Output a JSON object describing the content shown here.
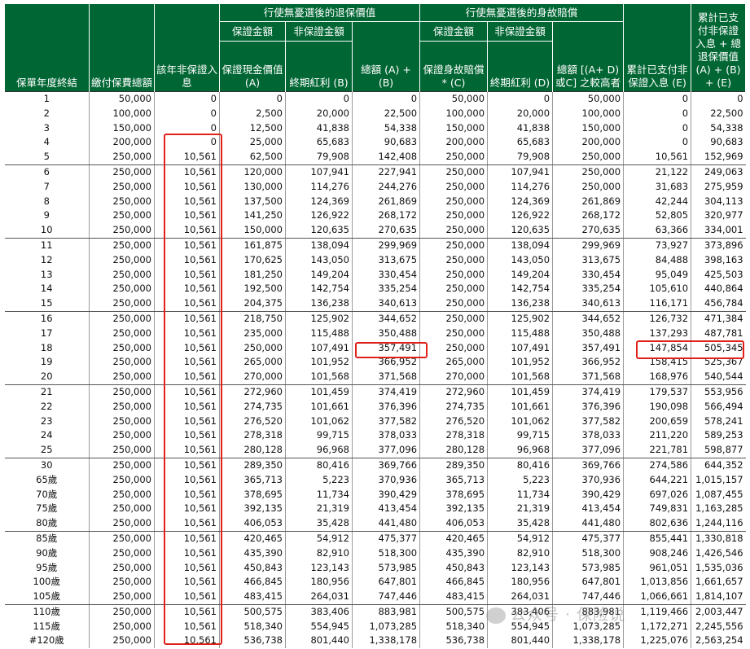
{
  "headers": {
    "col0": "保單年度終結",
    "col1": "繳付保費總額",
    "col2": "該年非保證入息",
    "group_surrender": "行使無憂選後的退保價值",
    "group_death": "行使無憂選後的身故賠償",
    "guaranteed": "保證金額",
    "non_guaranteed": "非保證金額",
    "guaranteed_cash_value": "保證現金價值 (A)",
    "terminal_bonus": "終期紅利 (B)",
    "total_surrender": "總額 (A) + (B)",
    "guaranteed_death_benefit": "保證身故賠償* (C)",
    "terminal_bonus_death": "終期紅利 (D)",
    "total_death": "總額 [(A+ D) 或C] 之較高者",
    "cumulative_income": "累計已支付非保證入息 (E)",
    "cumulative_total": "累計已支付非保證入息 + 總退保價值 (A) + (B) + (E)"
  },
  "rows": [
    [
      "1",
      "50,000",
      "0",
      "0",
      "0",
      "0",
      "50,000",
      "0",
      "50,000",
      "0",
      "0"
    ],
    [
      "2",
      "100,000",
      "0",
      "2,500",
      "20,000",
      "22,500",
      "100,000",
      "20,000",
      "100,000",
      "0",
      "22,500"
    ],
    [
      "3",
      "150,000",
      "0",
      "12,500",
      "41,838",
      "54,338",
      "150,000",
      "41,838",
      "150,000",
      "0",
      "54,338"
    ],
    [
      "4",
      "200,000",
      "0",
      "25,000",
      "65,683",
      "90,683",
      "200,000",
      "65,683",
      "200,000",
      "0",
      "90,683"
    ],
    [
      "5",
      "250,000",
      "10,561",
      "62,500",
      "79,908",
      "142,408",
      "250,000",
      "79,908",
      "250,000",
      "10,561",
      "152,969"
    ],
    [
      "6",
      "250,000",
      "10,561",
      "120,000",
      "107,941",
      "227,941",
      "250,000",
      "107,941",
      "250,000",
      "21,122",
      "249,063"
    ],
    [
      "7",
      "250,000",
      "10,561",
      "130,000",
      "114,276",
      "244,276",
      "250,000",
      "114,276",
      "250,000",
      "31,683",
      "275,959"
    ],
    [
      "8",
      "250,000",
      "10,561",
      "137,500",
      "124,369",
      "261,869",
      "250,000",
      "124,369",
      "261,869",
      "42,244",
      "304,113"
    ],
    [
      "9",
      "250,000",
      "10,561",
      "141,250",
      "126,922",
      "268,172",
      "250,000",
      "126,922",
      "268,172",
      "52,805",
      "320,977"
    ],
    [
      "10",
      "250,000",
      "10,561",
      "150,000",
      "120,635",
      "270,635",
      "250,000",
      "120,635",
      "270,635",
      "63,366",
      "334,001"
    ],
    [
      "11",
      "250,000",
      "10,561",
      "161,875",
      "138,094",
      "299,969",
      "250,000",
      "138,094",
      "299,969",
      "73,927",
      "373,896"
    ],
    [
      "12",
      "250,000",
      "10,561",
      "170,625",
      "143,050",
      "313,675",
      "250,000",
      "143,050",
      "313,675",
      "84,488",
      "398,163"
    ],
    [
      "13",
      "250,000",
      "10,561",
      "181,250",
      "149,204",
      "330,454",
      "250,000",
      "149,204",
      "330,454",
      "95,049",
      "425,503"
    ],
    [
      "14",
      "250,000",
      "10,561",
      "192,500",
      "142,754",
      "335,254",
      "250,000",
      "142,754",
      "335,254",
      "105,610",
      "440,864"
    ],
    [
      "15",
      "250,000",
      "10,561",
      "204,375",
      "136,238",
      "340,613",
      "250,000",
      "136,238",
      "340,613",
      "116,171",
      "456,784"
    ],
    [
      "16",
      "250,000",
      "10,561",
      "218,750",
      "125,902",
      "344,652",
      "250,000",
      "125,902",
      "344,652",
      "126,732",
      "471,384"
    ],
    [
      "17",
      "250,000",
      "10,561",
      "235,000",
      "115,488",
      "350,488",
      "250,000",
      "115,488",
      "350,488",
      "137,293",
      "487,781"
    ],
    [
      "18",
      "250,000",
      "10,561",
      "250,000",
      "107,491",
      "357,491",
      "250,000",
      "107,491",
      "357,491",
      "147,854",
      "505,345"
    ],
    [
      "19",
      "250,000",
      "10,561",
      "265,000",
      "101,952",
      "366,952",
      "265,000",
      "101,952",
      "366,952",
      "158,415",
      "525,367"
    ],
    [
      "20",
      "250,000",
      "10,561",
      "270,000",
      "101,568",
      "371,568",
      "270,000",
      "101,568",
      "371,568",
      "168,976",
      "540,544"
    ],
    [
      "21",
      "250,000",
      "10,561",
      "272,960",
      "101,459",
      "374,419",
      "272,960",
      "101,459",
      "374,419",
      "179,537",
      "553,956"
    ],
    [
      "22",
      "250,000",
      "10,561",
      "274,735",
      "101,661",
      "376,396",
      "274,735",
      "101,661",
      "376,396",
      "190,098",
      "566,494"
    ],
    [
      "23",
      "250,000",
      "10,561",
      "276,520",
      "101,062",
      "377,582",
      "276,520",
      "101,062",
      "377,582",
      "200,659",
      "578,241"
    ],
    [
      "24",
      "250,000",
      "10,561",
      "278,318",
      "99,715",
      "378,033",
      "278,318",
      "99,715",
      "378,033",
      "211,220",
      "589,253"
    ],
    [
      "25",
      "250,000",
      "10,561",
      "280,128",
      "96,968",
      "377,096",
      "280,128",
      "96,968",
      "377,096",
      "221,781",
      "598,877"
    ],
    [
      "30",
      "250,000",
      "10,561",
      "289,350",
      "80,416",
      "369,766",
      "289,350",
      "80,416",
      "369,766",
      "274,586",
      "644,352"
    ],
    [
      "65歲",
      "250,000",
      "10,561",
      "365,713",
      "5,223",
      "370,936",
      "365,713",
      "5,223",
      "370,936",
      "644,221",
      "1,015,157"
    ],
    [
      "70歲",
      "250,000",
      "10,561",
      "378,695",
      "11,734",
      "390,429",
      "378,695",
      "11,734",
      "390,429",
      "697,026",
      "1,087,455"
    ],
    [
      "75歲",
      "250,000",
      "10,561",
      "392,135",
      "21,319",
      "413,454",
      "392,135",
      "21,319",
      "413,454",
      "749,831",
      "1,163,285"
    ],
    [
      "80歲",
      "250,000",
      "10,561",
      "406,053",
      "35,428",
      "441,480",
      "406,053",
      "35,428",
      "441,480",
      "802,636",
      "1,244,116"
    ],
    [
      "85歲",
      "250,000",
      "10,561",
      "420,465",
      "54,912",
      "475,377",
      "420,465",
      "54,912",
      "475,377",
      "855,441",
      "1,330,818"
    ],
    [
      "90歲",
      "250,000",
      "10,561",
      "435,390",
      "82,910",
      "518,300",
      "435,390",
      "82,910",
      "518,300",
      "908,246",
      "1,426,546"
    ],
    [
      "95歲",
      "250,000",
      "10,561",
      "450,843",
      "123,143",
      "573,985",
      "450,843",
      "123,143",
      "573,985",
      "961,051",
      "1,535,036"
    ],
    [
      "100歲",
      "250,000",
      "10,561",
      "466,845",
      "180,956",
      "647,801",
      "466,845",
      "180,956",
      "647,801",
      "1,013,856",
      "1,661,657"
    ],
    [
      "105歲",
      "250,000",
      "10,561",
      "483,415",
      "264,031",
      "747,446",
      "483,415",
      "264,031",
      "747,446",
      "1,066,661",
      "1,814,107"
    ],
    [
      "110歲",
      "250,000",
      "10,561",
      "500,575",
      "383,406",
      "883,981",
      "500,575",
      "383,406",
      "883,981",
      "1,119,466",
      "2,003,447"
    ],
    [
      "115歲",
      "250,000",
      "10,561",
      "518,340",
      "554,945",
      "1,073,285",
      "518,340",
      "554,945",
      "1,073,285",
      "1,172,271",
      "2,245,556"
    ],
    [
      "#120歲",
      "250,000",
      "10,561",
      "536,738",
      "801,440",
      "1,338,178",
      "536,738",
      "801,440",
      "1,338,178",
      "1,225,076",
      "2,563,254"
    ]
  ],
  "group_ends": [
    4,
    9,
    14,
    19,
    24,
    29,
    34
  ],
  "highlight_color": "#e0201a",
  "header_color": "#006633",
  "watermark": "公众号 · 保险说"
}
